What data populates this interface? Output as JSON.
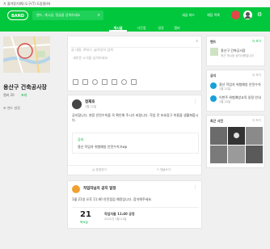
{
  "osbar": {
    "text": "가  즐겨찾기(N)   도구(T)   도움말(H)"
  },
  "header": {
    "logo": "BAND",
    "search_placeholder": "밴드, 게시글, 댓글을 검색하세요",
    "link_1": "새글 피드",
    "link_2": "채팅 목록"
  },
  "tabs": [
    "게시글",
    "사진첩",
    "일정",
    "멤버"
  ],
  "band": {
    "name": "용산구 건축공사장",
    "members_label": "멤버 20",
    "invite_label": "초대",
    "info_label": "밴드 설정"
  },
  "composer": {
    "search_placeholder": "글 내용, #태그, @작성자 검색",
    "write_placeholder": "새로운 소식을 남겨보세요."
  },
  "post": {
    "author": "정재호",
    "time": "1월 22일",
    "body": "공지합니다. 현장 안전수칙을 꼭 확인해 주시기 바랍니다. 작업 전 보호장구 착용을 생활화합시다.",
    "attachment_title": "공지",
    "attachment_text": "용산 작업자 위험예방 안전수칙.hwp",
    "like_label": "표정짓기",
    "comment_label": "댓글쓰기"
  },
  "schedule": {
    "title": "작업자님의 공지 일정",
    "subtitle": "1월 21일 오후 11:40 안전점검 예정입니다. 참석해주세요.",
    "day": "21",
    "month": "목요일",
    "event_title": "작업자들 11:40 공정",
    "event_time": "2021년 1월 21일"
  },
  "right": {
    "band_section": "밴드",
    "band_more": "더 보기",
    "band_name": "용산구 건축공사장",
    "band_desc": "최근 게시된 공지사항입니다",
    "notice_section": "공지",
    "notice_more": "더 보기",
    "notice_1": "용산 작업자 위험예방 안전수칙",
    "notice_1_time": "1월 22일",
    "notice_2": "이번주 위험예방교육 일정 안내",
    "notice_2_time": "1월 20일",
    "photos_section": "최근 사진",
    "photos_more": "더 보기"
  },
  "colors": {
    "brand": "#00c73c",
    "accent": "#00b33c",
    "avatar_red": "#e04848",
    "avatar_teal": "#1a9fd6"
  }
}
